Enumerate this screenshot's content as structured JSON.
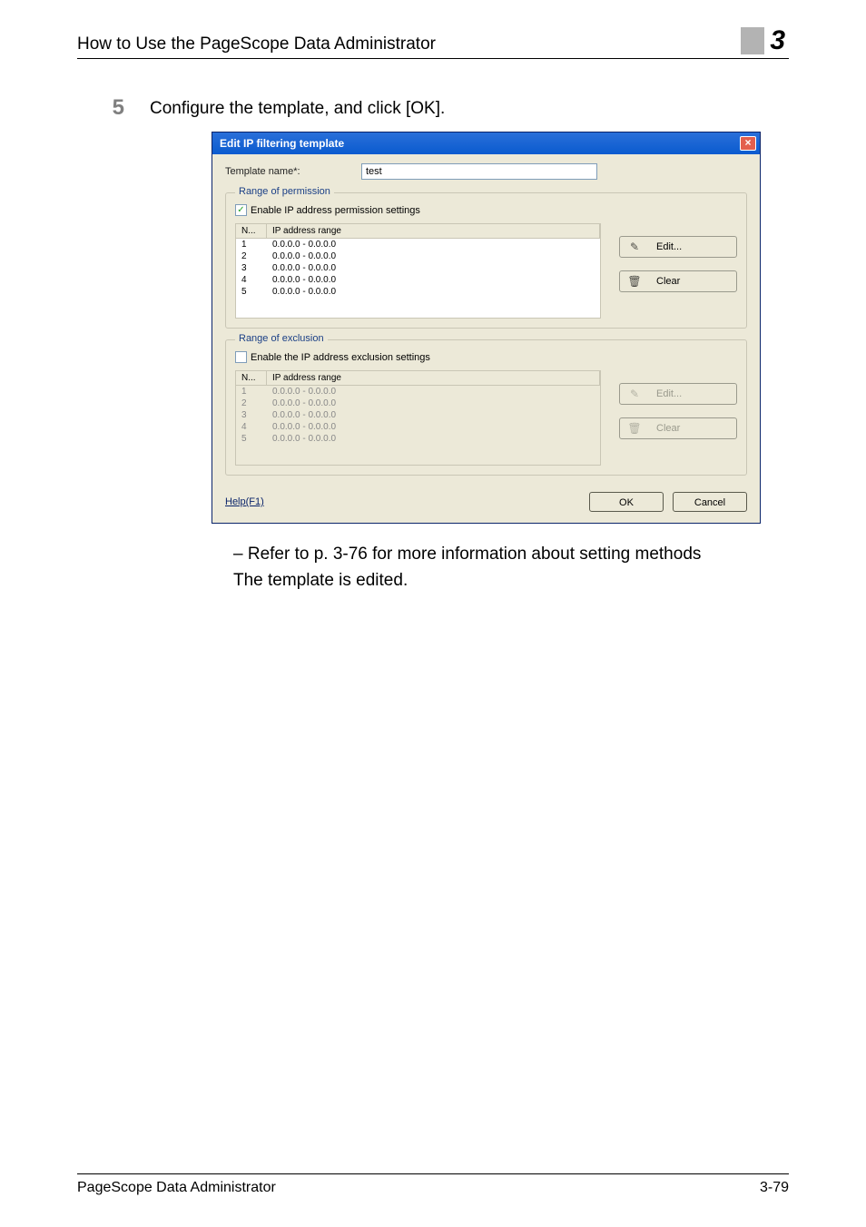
{
  "header": {
    "title": "How to Use the PageScope Data Administrator",
    "chapter": "3"
  },
  "step": {
    "number": "5",
    "text": "Configure the template, and click [OK]."
  },
  "dialog": {
    "title": "Edit IP filtering template",
    "close_x": "×",
    "template_label": "Template name*:",
    "template_value": "test",
    "permission": {
      "legend": "Range of permission",
      "check_label": "Enable IP address permission settings",
      "col_n": "N...",
      "col_range": "IP address range",
      "rows": [
        {
          "n": "1",
          "r": "0.0.0.0 - 0.0.0.0"
        },
        {
          "n": "2",
          "r": "0.0.0.0 - 0.0.0.0"
        },
        {
          "n": "3",
          "r": "0.0.0.0 - 0.0.0.0"
        },
        {
          "n": "4",
          "r": "0.0.0.0 - 0.0.0.0"
        },
        {
          "n": "5",
          "r": "0.0.0.0 - 0.0.0.0"
        }
      ],
      "edit_label": "Edit...",
      "clear_label": "Clear"
    },
    "exclusion": {
      "legend": "Range of exclusion",
      "check_label": "Enable the IP address exclusion settings",
      "col_n": "N...",
      "col_range": "IP address range",
      "rows": [
        {
          "n": "1",
          "r": "0.0.0.0 - 0.0.0.0"
        },
        {
          "n": "2",
          "r": "0.0.0.0 - 0.0.0.0"
        },
        {
          "n": "3",
          "r": "0.0.0.0 - 0.0.0.0"
        },
        {
          "n": "4",
          "r": "0.0.0.0 - 0.0.0.0"
        },
        {
          "n": "5",
          "r": "0.0.0.0 - 0.0.0.0"
        }
      ],
      "edit_label": "Edit...",
      "clear_label": "Clear"
    },
    "help": "Help(F1)",
    "ok": "OK",
    "cancel": "Cancel"
  },
  "after": {
    "line1": "–    Refer to p. 3-76 for more information about setting methods",
    "line2": "The template is edited."
  },
  "footer": {
    "left": "PageScope Data Administrator",
    "right": "3-79"
  }
}
